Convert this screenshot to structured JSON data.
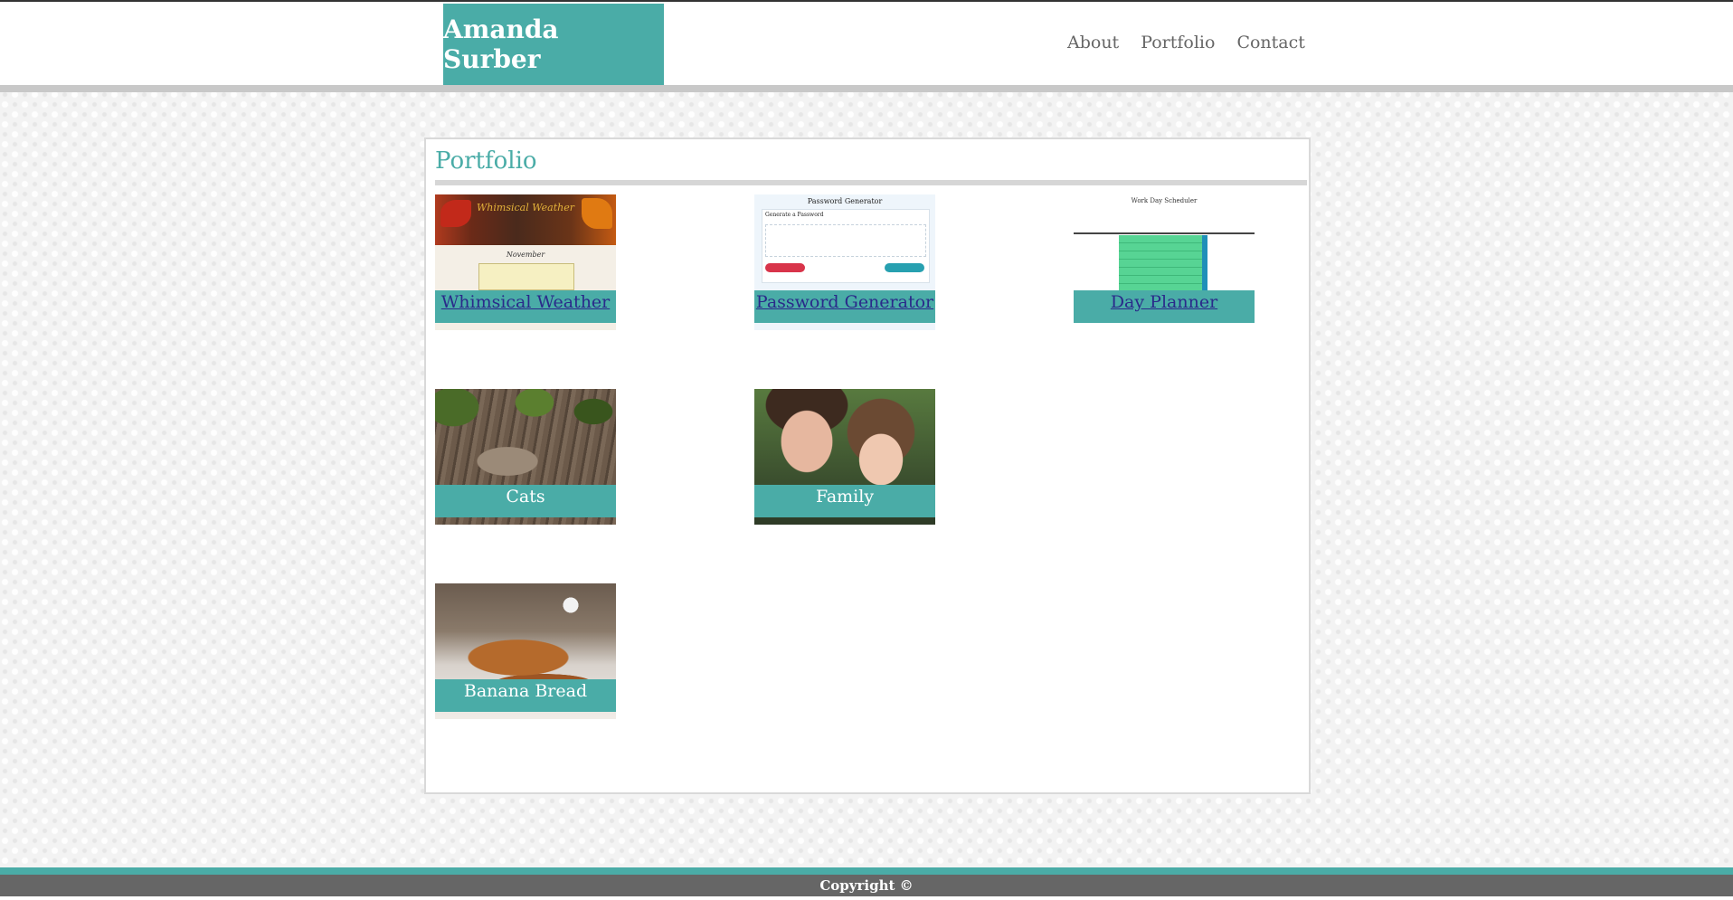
{
  "header": {
    "brand": "Amanda Surber",
    "nav": [
      {
        "label": "About"
      },
      {
        "label": "Portfolio"
      },
      {
        "label": "Contact"
      }
    ]
  },
  "portfolio": {
    "title": "Portfolio",
    "projects": [
      {
        "label": "Whimsical Weather",
        "linked": true
      },
      {
        "label": "Password Generator",
        "linked": true
      },
      {
        "label": "Day Planner",
        "linked": true
      },
      {
        "label": "Cats",
        "linked": false
      },
      {
        "label": "Family",
        "linked": false
      },
      {
        "label": "Banana Bread",
        "linked": false
      }
    ],
    "screenshots": {
      "weather": {
        "title": "Whimsical Weather",
        "month": "November"
      },
      "password": {
        "title": "Password Generator",
        "subtitle": "Generate a Password"
      },
      "planner": {
        "title": "Work Day Scheduler"
      }
    }
  },
  "footer": {
    "copyright": "Copyright ©"
  },
  "colors": {
    "accent": "#4aaca7",
    "footer": "#666666",
    "link": "#2a2a8a"
  }
}
